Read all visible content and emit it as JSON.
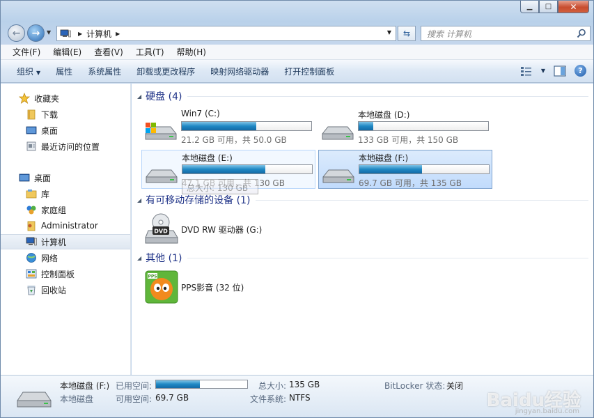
{
  "window": {
    "controls": {
      "minimize": "▁",
      "maximize": "□",
      "close": "✕"
    }
  },
  "address": {
    "crumbs": [
      "计算机"
    ],
    "search_placeholder": "搜索 计算机"
  },
  "menu": [
    "文件(F)",
    "编辑(E)",
    "查看(V)",
    "工具(T)",
    "帮助(H)"
  ],
  "commands": {
    "organize": "组织",
    "items": [
      "属性",
      "系统属性",
      "卸载或更改程序",
      "映射网络驱动器",
      "打开控制面板"
    ]
  },
  "nav": {
    "favorites": {
      "header": "收藏夹",
      "items": [
        "下载",
        "桌面",
        "最近访问的位置"
      ]
    },
    "tree": {
      "header": "桌面",
      "items": [
        "库",
        "家庭组",
        "Administrator",
        "计算机",
        "网络",
        "控制面板",
        "回收站"
      ]
    }
  },
  "groups": {
    "hard_disks": {
      "label": "硬盘 (4)",
      "drives": [
        {
          "name": "Win7 (C:)",
          "free_text": "21.2 GB 可用，共 50.0 GB",
          "used_fraction": 0.576
        },
        {
          "name": "本地磁盘 (D:)",
          "free_text": "133 GB 可用，共 150 GB",
          "used_fraction": 0.113
        },
        {
          "name": "本地磁盘 (E:)",
          "free_text": "47.1 GB 可用，共 130 GB",
          "used_fraction": 0.638
        },
        {
          "name": "本地磁盘 (F:)",
          "free_text": "69.7 GB 可用，共 135 GB",
          "used_fraction": 0.484
        }
      ],
      "tooltip": "总大小: 130 GB"
    },
    "removable": {
      "label": "有可移动存储的设备 (1)",
      "items": [
        {
          "name": "DVD RW 驱动器 (G:)"
        }
      ]
    },
    "other": {
      "label": "其他 (1)",
      "items": [
        {
          "name": "PPS影音 (32 位)"
        }
      ]
    }
  },
  "details": {
    "name": "本地磁盘 (F:)",
    "type": "本地磁盘",
    "used_label": "已用空间:",
    "free_label": "可用空间:",
    "free_value": "69.7 GB",
    "total_label": "总大小:",
    "total_value": "135 GB",
    "fs_label": "文件系统:",
    "fs_value": "NTFS",
    "bitlocker_label": "BitLocker 状态:",
    "bitlocker_value": "关闭",
    "used_fraction": 0.484
  },
  "watermark": {
    "main": "Baidu经验",
    "sub": "jingyan.baidu.com"
  }
}
